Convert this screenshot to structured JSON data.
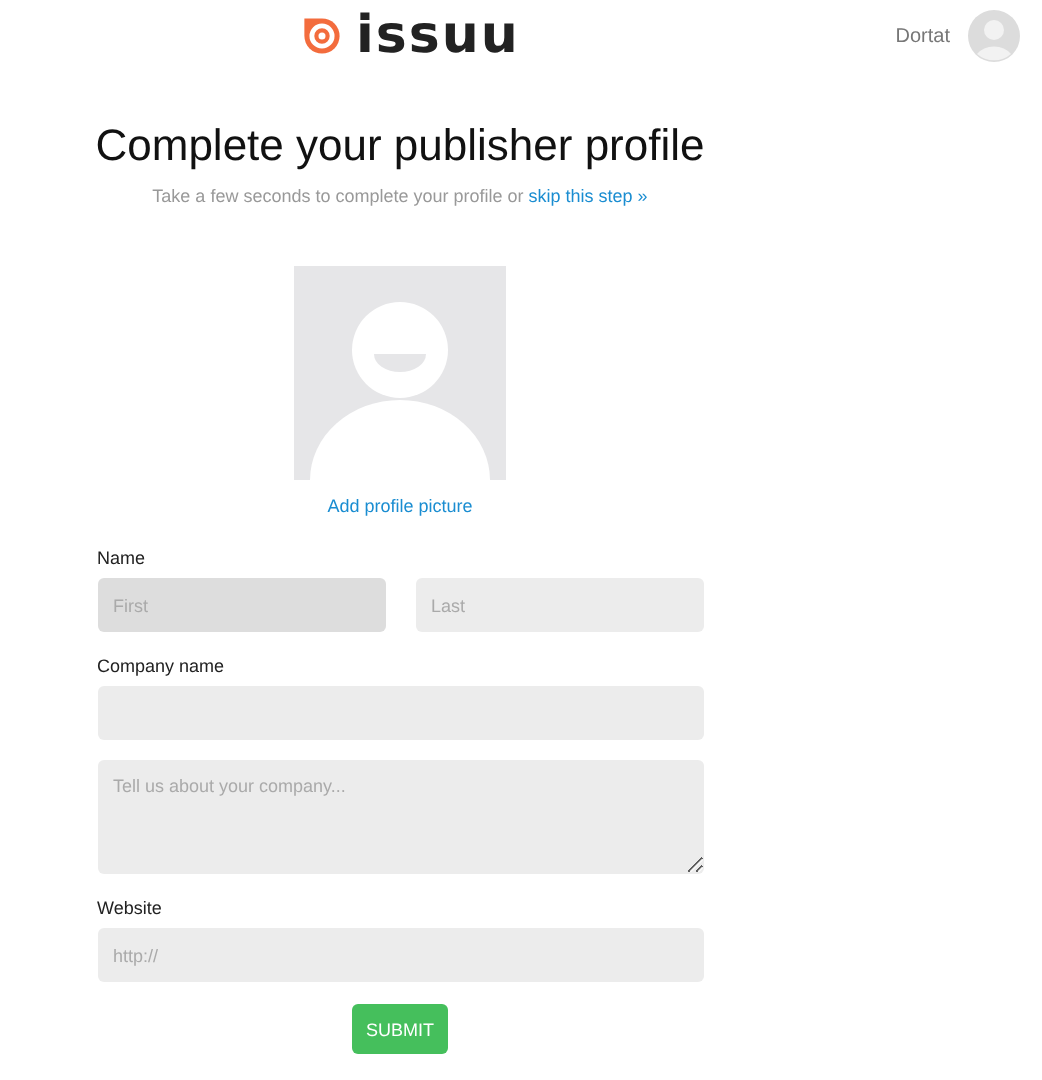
{
  "header": {
    "logo_text": "issuu",
    "user_name": "Dortat"
  },
  "title": "Complete your publisher profile",
  "subtitle": {
    "text": "Take a few seconds to complete your profile or ",
    "link": "skip this step »"
  },
  "profile_picture": {
    "link": "Add profile picture"
  },
  "form": {
    "name_label": "Name",
    "name_fields": [
      {
        "placeholder": "First",
        "focused": true
      },
      {
        "placeholder": "Last",
        "focused": false
      }
    ],
    "company_label": "Company name",
    "company_field": {
      "focused": false
    },
    "about_field": {
      "placeholder": "Tell us about your company...",
      "focused": false
    },
    "website_label": "Website",
    "website_field": {
      "placeholder": "http://",
      "focused": false
    },
    "submit": "SUBMIT"
  }
}
